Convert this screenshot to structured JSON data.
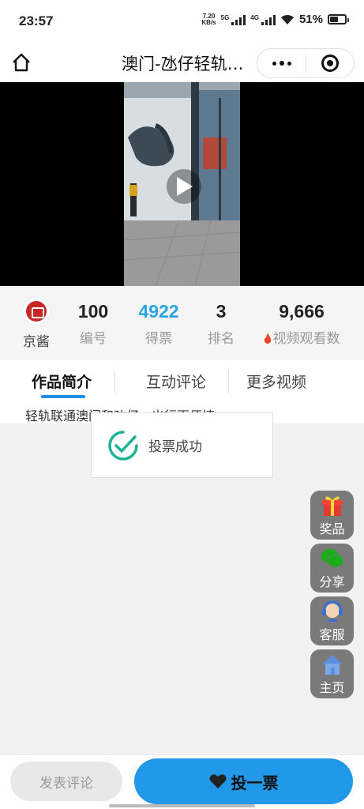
{
  "status_bar": {
    "time": "23:57",
    "net_speed_value": "7.20",
    "net_speed_unit": "KB/s",
    "sim1_label": "5G",
    "sim2_label": "4G",
    "battery_percent": "51%",
    "battery_level": 0.51
  },
  "nav": {
    "title": "澳门-氹仔轻轨…",
    "home_icon": "home-icon",
    "more_icon": "more-dots-icon",
    "close_icon": "mini-program-close-icon"
  },
  "video": {
    "play_icon": "play-icon"
  },
  "stats": {
    "author_name": "京酱",
    "number_value": "100",
    "number_label": "编号",
    "votes_value": "4922",
    "votes_label": "得票",
    "rank_value": "3",
    "rank_label": "排名",
    "views_value": "9,666",
    "views_label": "视频观看数",
    "votes_color": "#2aa4e8"
  },
  "tabs": [
    {
      "label": "作品简介",
      "active": true
    },
    {
      "label": "互动评论",
      "active": false
    },
    {
      "label": "更多视频",
      "active": false
    }
  ],
  "content": {
    "description": "轻轨联通澳门和氹仔，出行更便捷。"
  },
  "toast": {
    "message": "投票成功",
    "icon": "check-circle-icon"
  },
  "float_buttons": [
    {
      "label": "奖品",
      "icon": "gift-icon"
    },
    {
      "label": "分享",
      "icon": "wechat-icon"
    },
    {
      "label": "客服",
      "icon": "customer-service-icon"
    },
    {
      "label": "主页",
      "icon": "home-icon"
    }
  ],
  "bottom_bar": {
    "comment_label": "发表评论",
    "vote_label": "投一票",
    "vote_icon": "heart-icon",
    "accent_color": "#2199e8"
  }
}
